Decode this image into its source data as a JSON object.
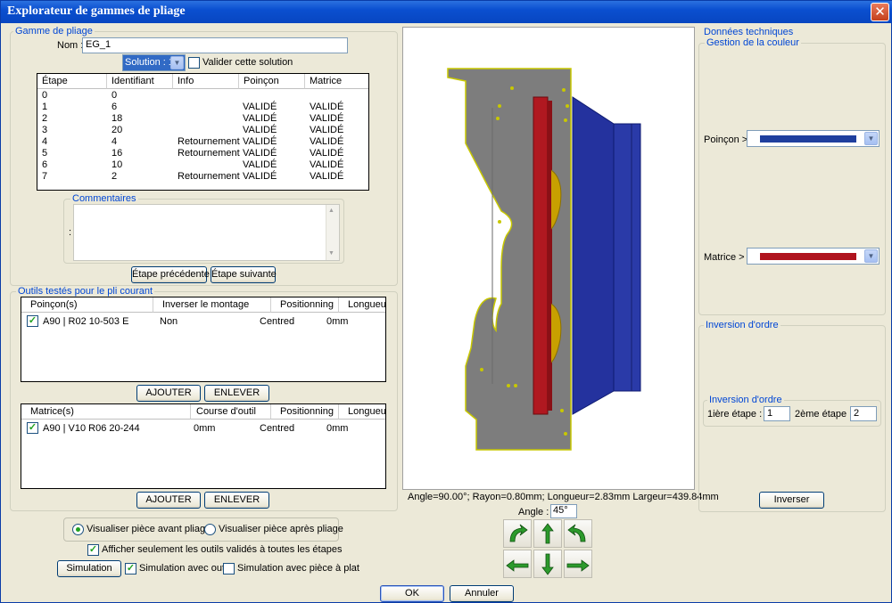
{
  "window": {
    "title": "Explorateur de gammes de pliage"
  },
  "gamme": {
    "legend": "Gamme de pliage",
    "nom_label": "Nom :",
    "nom_value": "EG_1",
    "solution_value": "Solution : 1",
    "valider_label": "Valider cette solution",
    "columns": [
      "Étape",
      "Identifiant",
      "Info",
      "Poinçon",
      "Matrice"
    ],
    "rows": [
      [
        "0",
        "0",
        "",
        "",
        ""
      ],
      [
        "1",
        "6",
        "",
        "VALIDÉ",
        "VALIDÉ"
      ],
      [
        "2",
        "18",
        "",
        "VALIDÉ",
        "VALIDÉ"
      ],
      [
        "3",
        "20",
        "",
        "VALIDÉ",
        "VALIDÉ"
      ],
      [
        "4",
        "4",
        "Retournement",
        "VALIDÉ",
        "VALIDÉ"
      ],
      [
        "5",
        "16",
        "Retournement",
        "VALIDÉ",
        "VALIDÉ"
      ],
      [
        "6",
        "10",
        "",
        "VALIDÉ",
        "VALIDÉ"
      ],
      [
        "7",
        "2",
        "Retournement",
        "VALIDÉ",
        "VALIDÉ"
      ]
    ],
    "commentaires_legend": "Commentaires",
    "commentaires_colon": ":",
    "etape_precedente": "Étape précédente",
    "etape_suivante": "Étape suivante"
  },
  "outils": {
    "legend": "Outils testés pour le pli courant",
    "poincons": {
      "columns": [
        "Poinçon(s)",
        "Inverser le montage",
        "Positionning",
        "Longueur"
      ],
      "rows": [
        {
          "name": "A90 | R02 10-503 E",
          "c2": "Non",
          "c3": "Centred",
          "c4": "0mm",
          "checked": true
        }
      ]
    },
    "matrices": {
      "columns": [
        "Matrice(s)",
        "Course d'outil",
        "Positionning",
        "Longueur"
      ],
      "rows": [
        {
          "name": "A90 | V10 R06 20-244",
          "c2": "0mm",
          "c3": "Centred",
          "c4": "0mm",
          "checked": true
        }
      ]
    },
    "ajouter": "AJOUTER",
    "enlever": "ENLEVER"
  },
  "options": {
    "radio_avant": "Visualiser pièce avant pliage",
    "radio_apres": "Visualiser pièce après pliage",
    "afficher_outils": "Afficher seulement les outils validés à toutes les étapes",
    "simulation_btn": "Simulation",
    "simulation_outil": "Simulation avec outil",
    "simulation_plat": "Simulation avec pièce à plat"
  },
  "viewer": {
    "info": "Angle=90.00°;  Rayon=0.80mm;  Longueur=2.83mm Largeur=439.84mm",
    "angle_label": "Angle :",
    "angle_value": "45°"
  },
  "tech": {
    "legend": "Données techniques",
    "couleur_legend": "Gestion de la couleur",
    "poincon_label": "Poinçon >",
    "poincon_color": "#1f3f9e",
    "matrice_label": "Matrice >",
    "matrice_color": "#b0141e",
    "inversion_legend": "Inversion d'ordre",
    "inversion_inner_legend": "Inversion d'ordre",
    "premiere_label": "1ière étape  :",
    "premiere_value": "1",
    "deuxieme_label": "2ème étape :",
    "deuxieme_value": "2",
    "inverser_btn": "Inverser"
  },
  "footer": {
    "ok": "OK",
    "annuler": "Annuler"
  }
}
